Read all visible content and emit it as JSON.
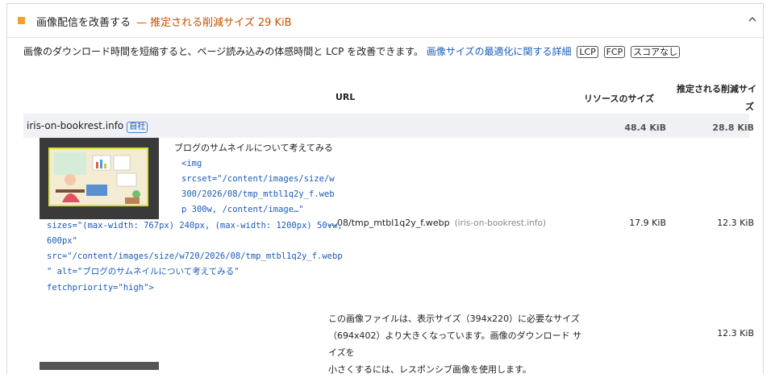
{
  "audit": {
    "title": "画像配信を改善する",
    "savings_label": "— 推定される削減サイズ 29 KiB",
    "collapse_icon": "chevron-up-icon",
    "accent_color": "#f0a030",
    "description_prefix": "画像のダウンロード時間を短縮すると、ページ読み込みの体感時間と LCP を改善できます。",
    "description_link": "画像サイズの最適化に関する詳細",
    "tags": [
      "LCP",
      "FCP",
      "スコアなし"
    ]
  },
  "table": {
    "col_url": "URL",
    "col_resource_size": "リソースのサイズ",
    "col_savings_line1": "推定される削減サイ",
    "col_savings_line2": "ズ",
    "group": {
      "host": "iris-on-bookrest.info",
      "badge": "自社",
      "resource_size": "48.4 KiB",
      "savings": "28.8 KiB"
    },
    "rows": [
      {
        "node_label": "ブログのサムネイルについて考えてみる",
        "snippet_lines": [
          "<img",
          "srcset=\"/content/images/size/w",
          "300/2026/08/tmp_mtbl1q2y_f.web",
          "p 300w, /content/image…\"",
          "sizes=\"(max-width: 767px) 240px, (max-width: 1200px) 50vw,",
          "600px\"",
          "src=\"/content/images/size/w720/2026/08/tmp_mtbl1q2y_f.webp",
          "\" alt=\"ブログのサムネイルについて考えてみる\"",
          "fetchpriority=\"high\">"
        ],
        "url": "…08/tmp_mtbl1q2y_f.webp",
        "url_host": "(iris-on-bookrest.info)",
        "resource_size": "17.9 KiB",
        "savings": "12.3 KiB"
      }
    ],
    "subitem": {
      "note_line1": "この画像ファイルは、表示サイズ（394x220）に必要なサイズ",
      "note_line2": "（694x402）より大きくなっています。画像のダウンロード サイズを",
      "note_line3": "小さくするには、レスポンシブ画像を使用します。",
      "savings": "12.3 KiB"
    }
  }
}
